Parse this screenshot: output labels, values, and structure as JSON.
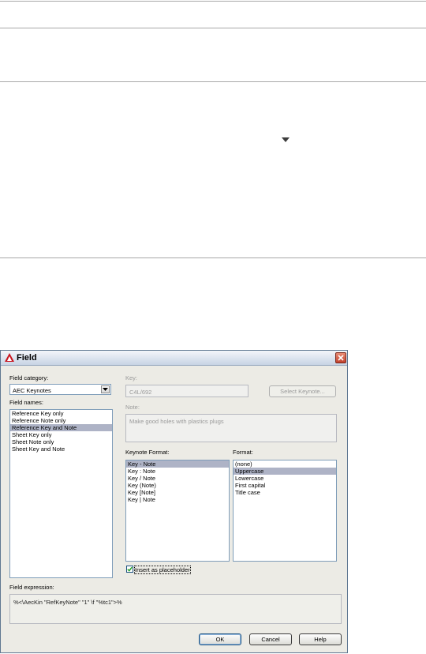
{
  "dialog": {
    "title": "Field",
    "field_category": {
      "label": "Field category:",
      "value": "AEC Keynotes"
    },
    "field_names": {
      "label": "Field names:",
      "items": [
        "Reference Key only",
        "Reference Note only",
        "Reference Key and Note",
        "Sheet Key only",
        "Sheet Note only",
        "Sheet Key and Note"
      ],
      "selected": "Reference Key and Note"
    },
    "key": {
      "label": "Key:",
      "value": "C4L/692"
    },
    "select_keynote_label": "Select Keynote...",
    "note": {
      "label": "Note:",
      "value": "Make good holes with plastics plugs"
    },
    "keynote_format": {
      "label": "Keynote Format:",
      "items": [
        "Key - Note",
        "Key : Note",
        "Key / Note",
        "Key (Note)",
        "Key [Note]",
        "Key | Note"
      ],
      "selected": "Key - Note"
    },
    "format": {
      "label": "Format:",
      "items": [
        "(none)",
        "Uppercase",
        "Lowercase",
        "First capital",
        "Title case"
      ],
      "selected": "Uppercase"
    },
    "insert_placeholder": {
      "label": "Insert as placeholder",
      "checked": true
    },
    "field_expression": {
      "label": "Field expression:",
      "value": "%<\\AecKin \"RefKeyNote\" \"1\" \\f \"%tc1\">%"
    },
    "buttons": {
      "ok": "OK",
      "cancel": "Cancel",
      "help": "Help"
    }
  },
  "colors": {
    "selection": "#aeb3c6",
    "dialog_bg": "#ecebe5",
    "close_button": "#c3422d"
  }
}
